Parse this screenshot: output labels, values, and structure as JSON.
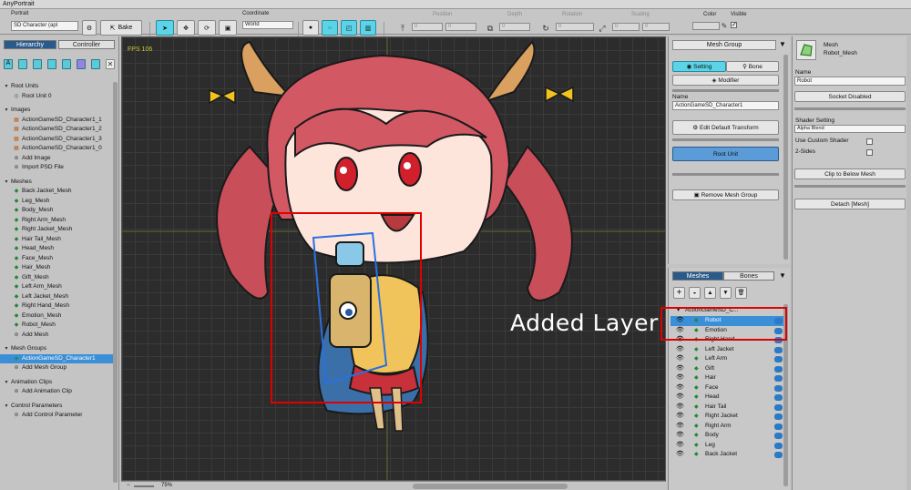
{
  "window": {
    "title": "AnyPortrait"
  },
  "toolbar": {
    "portrait_label": "Portrait",
    "portrait_value": "SD Character (apl",
    "bake_label": "Bake",
    "coordinate_label": "Coordinate",
    "coordinate_value": "World",
    "position_label": "Position",
    "position_x": "0",
    "position_y": "0",
    "depth_label": "Depth",
    "depth_value": "0",
    "rotation_label": "Rotation",
    "rotation_value": "0",
    "scaling_label": "Scaling",
    "scaling_x": "0",
    "scaling_y": "0",
    "color_label": "Color",
    "visible_label": "Visible"
  },
  "left": {
    "tab_hierarchy": "Hierarchy",
    "tab_controller": "Controller",
    "rows": [
      {
        "label": "Root Units",
        "kind": "section"
      },
      {
        "label": "Root Unit 0",
        "kind": "item",
        "icon": "root"
      },
      {
        "label": "Images",
        "kind": "section"
      },
      {
        "label": "ActionGameSD_Character1_1",
        "kind": "item",
        "icon": "image"
      },
      {
        "label": "ActionGameSD_Character1_2",
        "kind": "item",
        "icon": "image"
      },
      {
        "label": "ActionGameSD_Character1_3",
        "kind": "item",
        "icon": "image"
      },
      {
        "label": "ActionGameSD_Character1_0",
        "kind": "item",
        "icon": "image"
      },
      {
        "label": "Add Image",
        "kind": "add"
      },
      {
        "label": "Import PSD File",
        "kind": "add"
      },
      {
        "label": "Meshes",
        "kind": "section"
      },
      {
        "label": "Back Jacket_Mesh",
        "kind": "item",
        "icon": "mesh"
      },
      {
        "label": "Leg_Mesh",
        "kind": "item",
        "icon": "mesh"
      },
      {
        "label": "Body_Mesh",
        "kind": "item",
        "icon": "mesh"
      },
      {
        "label": "Right Arm_Mesh",
        "kind": "item",
        "icon": "mesh"
      },
      {
        "label": "Right Jacket_Mesh",
        "kind": "item",
        "icon": "mesh"
      },
      {
        "label": "Hair Tail_Mesh",
        "kind": "item",
        "icon": "mesh"
      },
      {
        "label": "Head_Mesh",
        "kind": "item",
        "icon": "mesh"
      },
      {
        "label": "Face_Mesh",
        "kind": "item",
        "icon": "mesh"
      },
      {
        "label": "Hair_Mesh",
        "kind": "item",
        "icon": "mesh"
      },
      {
        "label": "Gift_Mesh",
        "kind": "item",
        "icon": "mesh"
      },
      {
        "label": "Left Arm_Mesh",
        "kind": "item",
        "icon": "mesh"
      },
      {
        "label": "Left Jacket_Mesh",
        "kind": "item",
        "icon": "mesh"
      },
      {
        "label": "Right Hand_Mesh",
        "kind": "item",
        "icon": "mesh"
      },
      {
        "label": "Emotion_Mesh",
        "kind": "item",
        "icon": "mesh"
      },
      {
        "label": "Robot_Mesh",
        "kind": "item",
        "icon": "mesh"
      },
      {
        "label": "Add Mesh",
        "kind": "add"
      },
      {
        "label": "Mesh Groups",
        "kind": "section"
      },
      {
        "label": "ActionGameSD_Character1",
        "kind": "item",
        "icon": "group",
        "selected": true
      },
      {
        "label": "Add Mesh Group",
        "kind": "add"
      },
      {
        "label": "Animation Clips",
        "kind": "section"
      },
      {
        "label": "Add Animation Clip",
        "kind": "add"
      },
      {
        "label": "Control Parameters",
        "kind": "section"
      },
      {
        "label": "Add Control Parameter",
        "kind": "add"
      }
    ]
  },
  "canvas": {
    "fps": "FPS 106",
    "zoom": "75%"
  },
  "annotation": {
    "label": "Added Layer"
  },
  "meshgroup": {
    "header": "Mesh Group",
    "tab_setting": "Setting",
    "tab_bone": "Bone",
    "modifier_label": "Modifier",
    "name_label": "Name",
    "name_value": "ActionGameSD_Character1",
    "edit_transform": "Edit Default Transform",
    "root_unit": "Root Unit",
    "remove_group": "Remove Mesh Group"
  },
  "layers": {
    "tab_meshes": "Meshes",
    "tab_bones": "Bones",
    "root": "ActionGameSD_C...",
    "items": [
      {
        "label": "Robot",
        "selected": true
      },
      {
        "label": "Emotion"
      },
      {
        "label": "Right Hand"
      },
      {
        "label": "Left Jacket"
      },
      {
        "label": "Left Arm"
      },
      {
        "label": "Gift"
      },
      {
        "label": "Hair"
      },
      {
        "label": "Face"
      },
      {
        "label": "Head"
      },
      {
        "label": "Hair Tail"
      },
      {
        "label": "Right Jacket"
      },
      {
        "label": "Right Arm"
      },
      {
        "label": "Body"
      },
      {
        "label": "Leg"
      },
      {
        "label": "Back Jacket"
      }
    ]
  },
  "inspector": {
    "type_label": "Mesh",
    "object_name": "Robot_Mesh",
    "name_label": "Name",
    "name_value": "Robot",
    "socket_btn": "Socket Disabled",
    "shader_label": "Shader Setting",
    "shader_value": "Alpha Blend",
    "custom_shader": "Use Custom Shader",
    "two_sides": "2-Sides",
    "clip_btn": "Clip to Below Mesh",
    "detach_btn": "Detach [Mesh]"
  },
  "colors": {
    "accent": "#5ad4e6",
    "selection": "#3b8fd6",
    "annotation": "#e00000"
  }
}
